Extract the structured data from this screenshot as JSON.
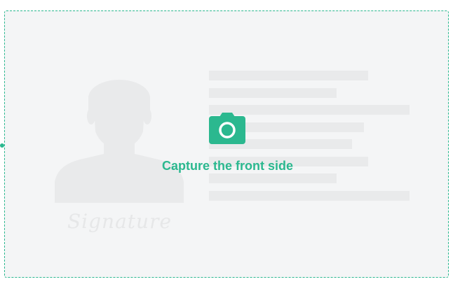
{
  "capture": {
    "label": "Capture the front side",
    "icon": "camera-icon",
    "accent_color": "#2bb88f"
  },
  "placeholder_card": {
    "portrait_icon": "person-silhouette-icon",
    "signature_text": "Signature",
    "placeholder_color": "#e9eaeb",
    "background_color": "#f4f5f6"
  }
}
